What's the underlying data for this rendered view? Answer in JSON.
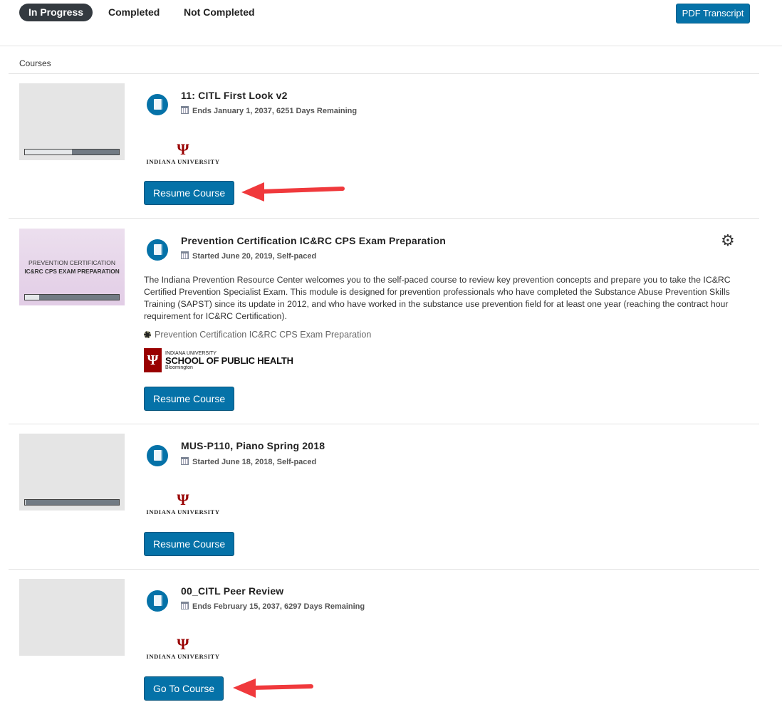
{
  "tabs": [
    {
      "label": "In Progress",
      "active": true
    },
    {
      "label": "Completed",
      "active": false
    },
    {
      "label": "Not Completed",
      "active": false
    }
  ],
  "pdf_button": "PDF Transcript",
  "section_label": "Courses",
  "colors": {
    "accent": "#0572a8",
    "active_tab": "#343a40",
    "iu_red": "#990000",
    "arrow": "#f0393c"
  },
  "courses": [
    {
      "title": "11: CITL First Look v2",
      "date": "Ends January 1, 2037, 6251 Days Remaining",
      "progress_percent": 50,
      "logo": "INDIANA UNIVERSITY",
      "button": "Resume Course",
      "icon": "book-icon"
    },
    {
      "title": "Prevention Certification IC&RC CPS Exam Preparation",
      "date": "Started June 20, 2019, Self-paced",
      "progress_percent": 15,
      "thumb_line1": "PREVENTION CERTIFICATION",
      "thumb_line2": "IC&RC CPS EXAM PREPARATION",
      "description": "The Indiana Prevention Resource Center welcomes you to the self-paced course to review key prevention concepts and prepare you to take the IC&RC Certified Prevention Specialist Exam. This module is designed for prevention professionals who have completed the Substance Abuse Prevention Skills Training (SAPST) since its update in 2012, and who have worked in the substance use prevention field for at least one year (reaching the contract hour requirement for IC&RC Certification).",
      "tag": "Prevention Certification IC&RC CPS Exam Preparation",
      "logo_top": "INDIANA UNIVERSITY",
      "logo_main": "SCHOOL OF PUBLIC HEALTH",
      "logo_sub": "Bloomington",
      "button": "Resume Course",
      "icon": "book-icon"
    },
    {
      "title": "MUS-P110, Piano Spring 2018",
      "date": "Started June 18, 2018, Self-paced",
      "progress_percent": 1,
      "logo": "INDIANA UNIVERSITY",
      "button": "Resume Course",
      "icon": "book-icon"
    },
    {
      "title": "00_CITL Peer Review",
      "date": "Ends February 15, 2037, 6297 Days Remaining",
      "logo": "INDIANA UNIVERSITY",
      "button": "Go To Course",
      "icon": "book-icon"
    }
  ]
}
